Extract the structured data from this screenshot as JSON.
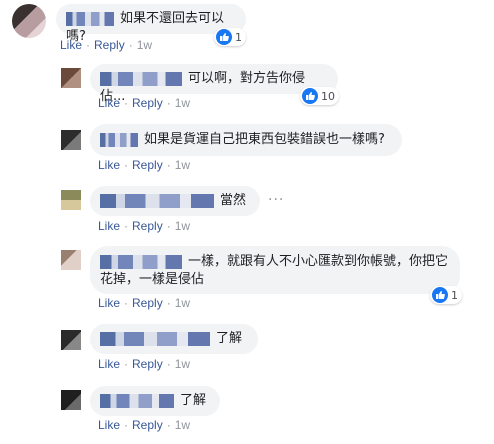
{
  "comments": [
    {
      "text": "如果不還回去可以嗎?",
      "like": "Like",
      "reply": "Reply",
      "time": "1w",
      "reactions": "1"
    },
    {
      "text": "可以啊，對方告你侵佔...",
      "like": "Like",
      "reply": "Reply",
      "time": "1w",
      "reactions": "10"
    },
    {
      "text": "如果是貨運自己把東西包裝錯誤也一樣嗎?",
      "like": "Like",
      "reply": "Reply",
      "time": "1w"
    },
    {
      "text": "當然",
      "like": "Like",
      "reply": "Reply",
      "time": "1w",
      "more": "···"
    },
    {
      "text_line1": "一樣，就跟有人不小心匯款到你帳號，你把它",
      "text_line2": "花掉，一樣是侵佔",
      "like": "Like",
      "reply": "Reply",
      "time": "1w",
      "reactions": "1"
    },
    {
      "text": "了解",
      "like": "Like",
      "reply": "Reply",
      "time": "1w"
    },
    {
      "text": "了解",
      "like": "Like",
      "reply": "Reply",
      "time": "1w"
    }
  ],
  "colors": {
    "link": "#385898",
    "bubble": "#f2f3f5",
    "like_blue": "#1877f2"
  }
}
